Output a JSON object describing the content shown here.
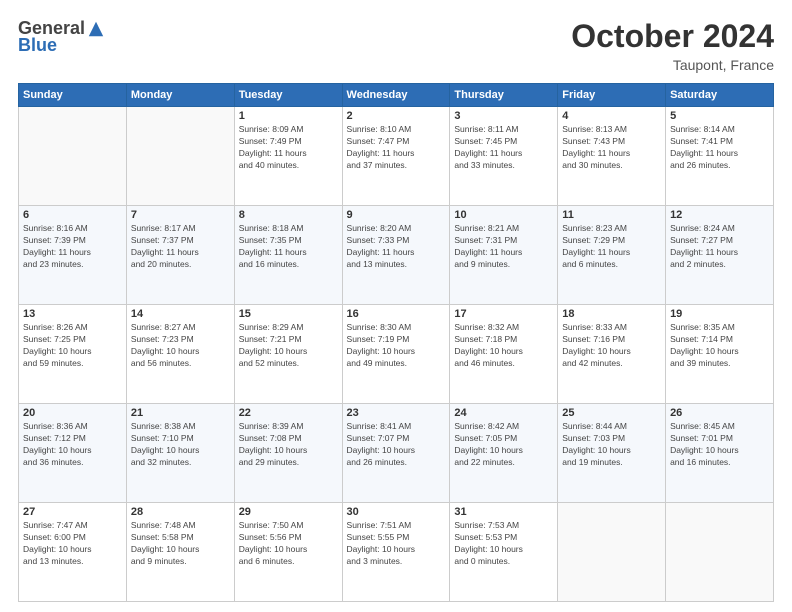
{
  "logo": {
    "general": "General",
    "blue": "Blue"
  },
  "header": {
    "month": "October 2024",
    "location": "Taupont, France"
  },
  "weekdays": [
    "Sunday",
    "Monday",
    "Tuesday",
    "Wednesday",
    "Thursday",
    "Friday",
    "Saturday"
  ],
  "weeks": [
    [
      {
        "day": "",
        "info": ""
      },
      {
        "day": "",
        "info": ""
      },
      {
        "day": "1",
        "info": "Sunrise: 8:09 AM\nSunset: 7:49 PM\nDaylight: 11 hours\nand 40 minutes."
      },
      {
        "day": "2",
        "info": "Sunrise: 8:10 AM\nSunset: 7:47 PM\nDaylight: 11 hours\nand 37 minutes."
      },
      {
        "day": "3",
        "info": "Sunrise: 8:11 AM\nSunset: 7:45 PM\nDaylight: 11 hours\nand 33 minutes."
      },
      {
        "day": "4",
        "info": "Sunrise: 8:13 AM\nSunset: 7:43 PM\nDaylight: 11 hours\nand 30 minutes."
      },
      {
        "day": "5",
        "info": "Sunrise: 8:14 AM\nSunset: 7:41 PM\nDaylight: 11 hours\nand 26 minutes."
      }
    ],
    [
      {
        "day": "6",
        "info": "Sunrise: 8:16 AM\nSunset: 7:39 PM\nDaylight: 11 hours\nand 23 minutes."
      },
      {
        "day": "7",
        "info": "Sunrise: 8:17 AM\nSunset: 7:37 PM\nDaylight: 11 hours\nand 20 minutes."
      },
      {
        "day": "8",
        "info": "Sunrise: 8:18 AM\nSunset: 7:35 PM\nDaylight: 11 hours\nand 16 minutes."
      },
      {
        "day": "9",
        "info": "Sunrise: 8:20 AM\nSunset: 7:33 PM\nDaylight: 11 hours\nand 13 minutes."
      },
      {
        "day": "10",
        "info": "Sunrise: 8:21 AM\nSunset: 7:31 PM\nDaylight: 11 hours\nand 9 minutes."
      },
      {
        "day": "11",
        "info": "Sunrise: 8:23 AM\nSunset: 7:29 PM\nDaylight: 11 hours\nand 6 minutes."
      },
      {
        "day": "12",
        "info": "Sunrise: 8:24 AM\nSunset: 7:27 PM\nDaylight: 11 hours\nand 2 minutes."
      }
    ],
    [
      {
        "day": "13",
        "info": "Sunrise: 8:26 AM\nSunset: 7:25 PM\nDaylight: 10 hours\nand 59 minutes."
      },
      {
        "day": "14",
        "info": "Sunrise: 8:27 AM\nSunset: 7:23 PM\nDaylight: 10 hours\nand 56 minutes."
      },
      {
        "day": "15",
        "info": "Sunrise: 8:29 AM\nSunset: 7:21 PM\nDaylight: 10 hours\nand 52 minutes."
      },
      {
        "day": "16",
        "info": "Sunrise: 8:30 AM\nSunset: 7:19 PM\nDaylight: 10 hours\nand 49 minutes."
      },
      {
        "day": "17",
        "info": "Sunrise: 8:32 AM\nSunset: 7:18 PM\nDaylight: 10 hours\nand 46 minutes."
      },
      {
        "day": "18",
        "info": "Sunrise: 8:33 AM\nSunset: 7:16 PM\nDaylight: 10 hours\nand 42 minutes."
      },
      {
        "day": "19",
        "info": "Sunrise: 8:35 AM\nSunset: 7:14 PM\nDaylight: 10 hours\nand 39 minutes."
      }
    ],
    [
      {
        "day": "20",
        "info": "Sunrise: 8:36 AM\nSunset: 7:12 PM\nDaylight: 10 hours\nand 36 minutes."
      },
      {
        "day": "21",
        "info": "Sunrise: 8:38 AM\nSunset: 7:10 PM\nDaylight: 10 hours\nand 32 minutes."
      },
      {
        "day": "22",
        "info": "Sunrise: 8:39 AM\nSunset: 7:08 PM\nDaylight: 10 hours\nand 29 minutes."
      },
      {
        "day": "23",
        "info": "Sunrise: 8:41 AM\nSunset: 7:07 PM\nDaylight: 10 hours\nand 26 minutes."
      },
      {
        "day": "24",
        "info": "Sunrise: 8:42 AM\nSunset: 7:05 PM\nDaylight: 10 hours\nand 22 minutes."
      },
      {
        "day": "25",
        "info": "Sunrise: 8:44 AM\nSunset: 7:03 PM\nDaylight: 10 hours\nand 19 minutes."
      },
      {
        "day": "26",
        "info": "Sunrise: 8:45 AM\nSunset: 7:01 PM\nDaylight: 10 hours\nand 16 minutes."
      }
    ],
    [
      {
        "day": "27",
        "info": "Sunrise: 7:47 AM\nSunset: 6:00 PM\nDaylight: 10 hours\nand 13 minutes."
      },
      {
        "day": "28",
        "info": "Sunrise: 7:48 AM\nSunset: 5:58 PM\nDaylight: 10 hours\nand 9 minutes."
      },
      {
        "day": "29",
        "info": "Sunrise: 7:50 AM\nSunset: 5:56 PM\nDaylight: 10 hours\nand 6 minutes."
      },
      {
        "day": "30",
        "info": "Sunrise: 7:51 AM\nSunset: 5:55 PM\nDaylight: 10 hours\nand 3 minutes."
      },
      {
        "day": "31",
        "info": "Sunrise: 7:53 AM\nSunset: 5:53 PM\nDaylight: 10 hours\nand 0 minutes."
      },
      {
        "day": "",
        "info": ""
      },
      {
        "day": "",
        "info": ""
      }
    ]
  ]
}
